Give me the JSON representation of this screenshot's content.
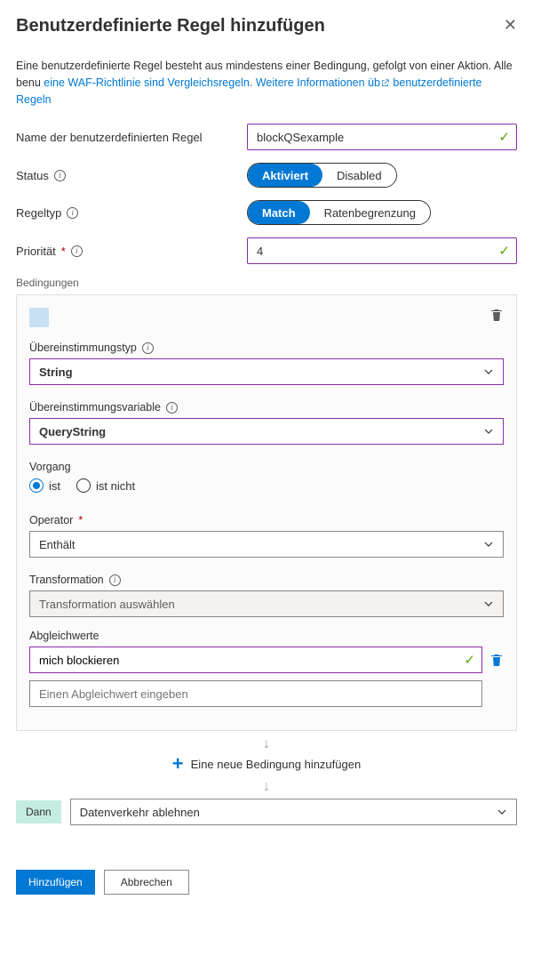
{
  "header": {
    "title": "Benutzerdefinierte Regel hinzufügen"
  },
  "intro": {
    "text_before": "Eine benutzerdefinierte Regel besteht aus mindestens einer Bedingung, gefolgt von einer Aktion. Alle benu",
    "text_link1": "eine WAF-Richtlinie sind Vergleichsregeln. Weitere Informationen üb",
    "text_link2": " benutzerdefinierte Regeln"
  },
  "fields": {
    "name_label": "Name der benutzerdefinierten Regel",
    "name_value": "blockQSexample",
    "status_label": "Status",
    "status_active": "Aktiviert",
    "status_disabled": "Disabled",
    "ruletype_label": "Regeltyp",
    "ruletype_match": "Match",
    "ruletype_rate": "Ratenbegrenzung",
    "priority_label": "Priorität",
    "priority_value": "4"
  },
  "conditions": {
    "section_label": "Bedingungen",
    "match_type_label": "Übereinstimmungstyp",
    "match_type_value": "String",
    "match_var_label": "Übereinstimmungsvariable",
    "match_var_value": "QueryString",
    "operation_label": "Vorgang",
    "op_is": "ist",
    "op_isnot": "ist nicht",
    "operator_label": "Operator",
    "operator_value": "Enthält",
    "transform_label": "Transformation",
    "transform_placeholder": "Transformation auswählen",
    "matchvalues_label": "Abgleichwerte",
    "matchvalue_1": "mich blockieren",
    "matchvalue_placeholder": "Einen Abgleichwert eingeben",
    "add_condition": "Eine neue Bedingung hinzufügen"
  },
  "then": {
    "label": "Dann",
    "action": "Datenverkehr ablehnen"
  },
  "footer": {
    "add": "Hinzufügen",
    "cancel": "Abbrechen"
  }
}
